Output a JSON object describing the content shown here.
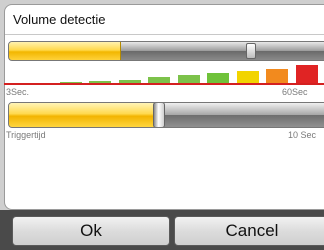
{
  "dialog": {
    "title": "Volume detectie"
  },
  "volume_level": {
    "level_fraction": 0.35,
    "threshold_fraction": 0.75
  },
  "meter": {
    "segments": [
      {
        "level": 0.05,
        "color": "#7cc24a"
      },
      {
        "level": 0.1,
        "color": "#7cc24a"
      },
      {
        "level": 0.15,
        "color": "#7cc24a"
      },
      {
        "level": 0.2,
        "color": "#7cc24a"
      },
      {
        "level": 0.3,
        "color": "#7cc24a"
      },
      {
        "level": 0.4,
        "color": "#7cc24a"
      },
      {
        "level": 0.5,
        "color": "#6fc23a"
      },
      {
        "level": 0.6,
        "color": "#f2d400"
      },
      {
        "level": 0.7,
        "color": "#f28a1e"
      },
      {
        "level": 0.85,
        "color": "#e02424"
      }
    ],
    "threshold_color": "#d42020"
  },
  "scale": {
    "min_label": "3Sec.",
    "max_label": "60Sec"
  },
  "trigger": {
    "label": "Triggertijd",
    "value_label": "10 Sec",
    "value_fraction": 0.47
  },
  "buttons": {
    "ok_label": "Ok",
    "cancel_label": "Cancel"
  },
  "colors": {
    "accent": "#ffd84a",
    "bar_dark": "#4a4a4a"
  }
}
